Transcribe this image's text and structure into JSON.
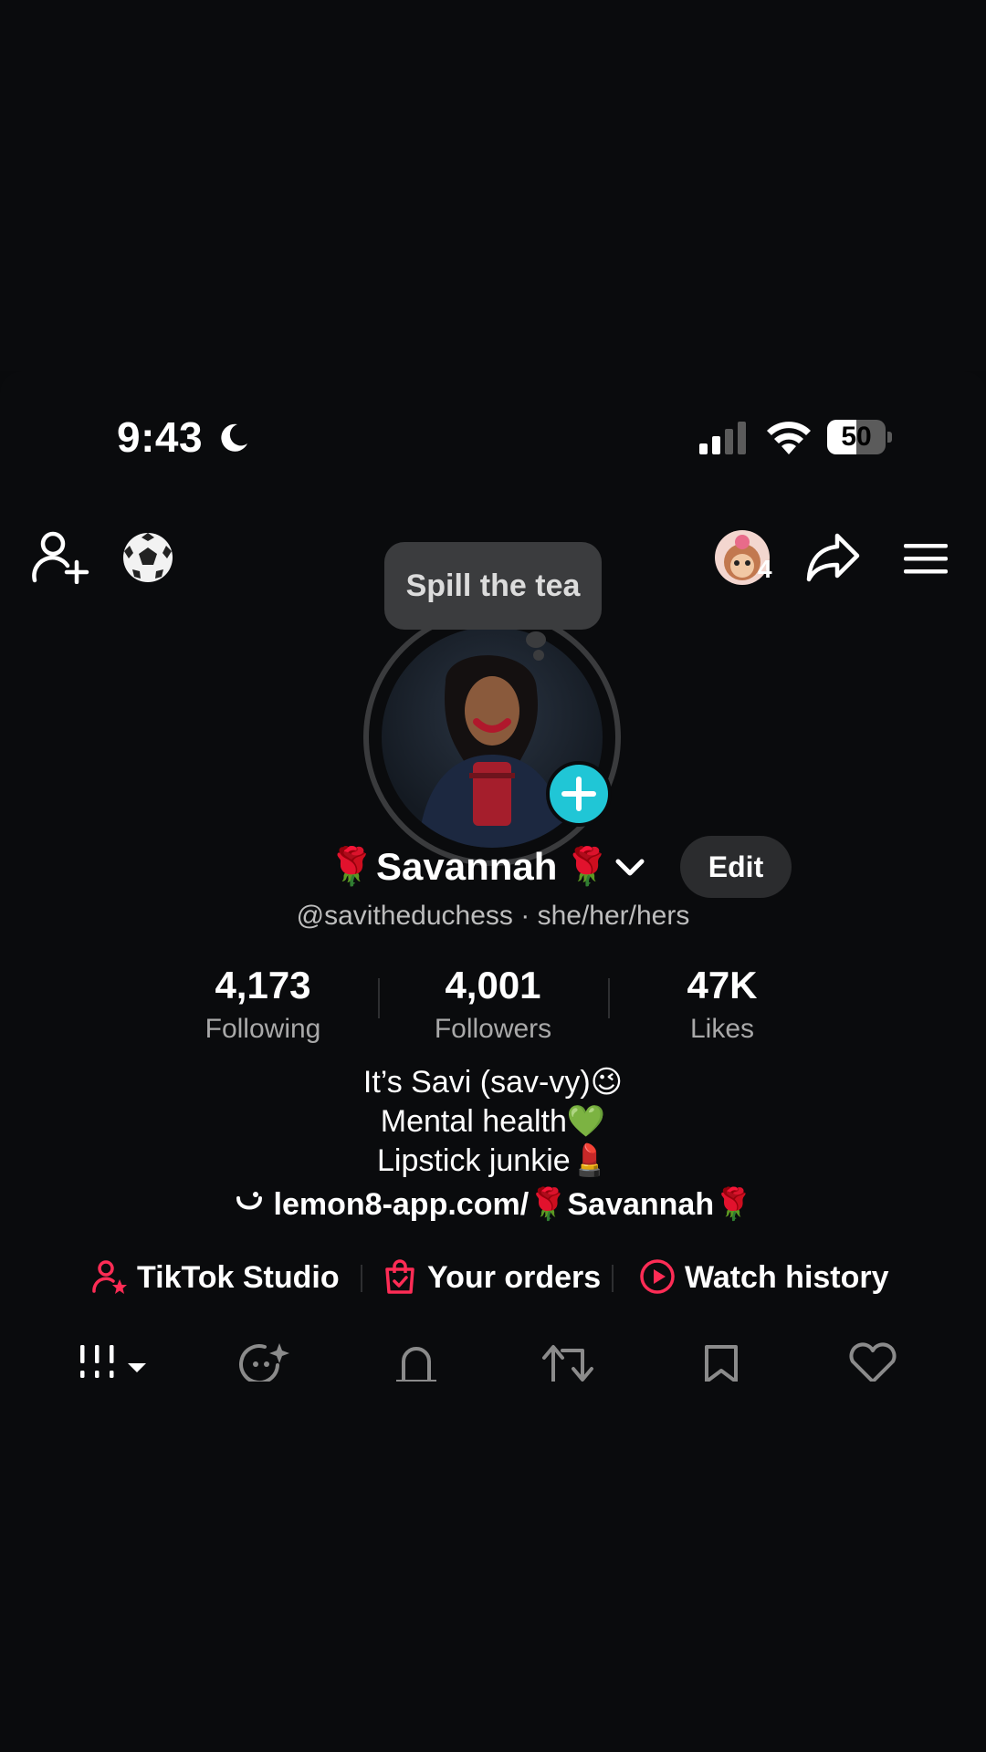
{
  "status_bar": {
    "time": "9:43",
    "battery": "50",
    "battery_fraction": 0.5
  },
  "header": {
    "avatar_badge_count": "4",
    "icons": [
      "add-friend-icon",
      "soccer-icon",
      "avatar",
      "share-icon",
      "menu-icon"
    ]
  },
  "profile": {
    "tooltip": "Spill the tea",
    "name": "Savannah",
    "name_emoji": "🌹",
    "edit_label": "Edit",
    "handle_line": "@savitheduchess · she/her/hers"
  },
  "stats": [
    {
      "value": "4,173",
      "label": "Following"
    },
    {
      "value": "4,001",
      "label": "Followers"
    },
    {
      "value": "47K",
      "label": "Likes"
    }
  ],
  "bio": {
    "line1": "It’s Savi (sav-vy)😉",
    "line2": "Mental health💚",
    "line3": "Lipstick junkie💄",
    "link": "lemon8-app.com/🌹Savannah🌹"
  },
  "quick_links": [
    {
      "label": "TikTok Studio",
      "icon": "creator-icon"
    },
    {
      "label": "Your orders",
      "icon": "shopping-bag-icon"
    },
    {
      "label": "Watch history",
      "icon": "play-circle-icon"
    }
  ],
  "tabs": [
    "grid-icon",
    "ai-face-icon",
    "lock-icon",
    "repost-icon",
    "bookmark-icon",
    "heart-icon"
  ],
  "colors": {
    "background": "#0a0b0d",
    "accent": "#fe2c55",
    "add_button": "#20c6d6"
  }
}
